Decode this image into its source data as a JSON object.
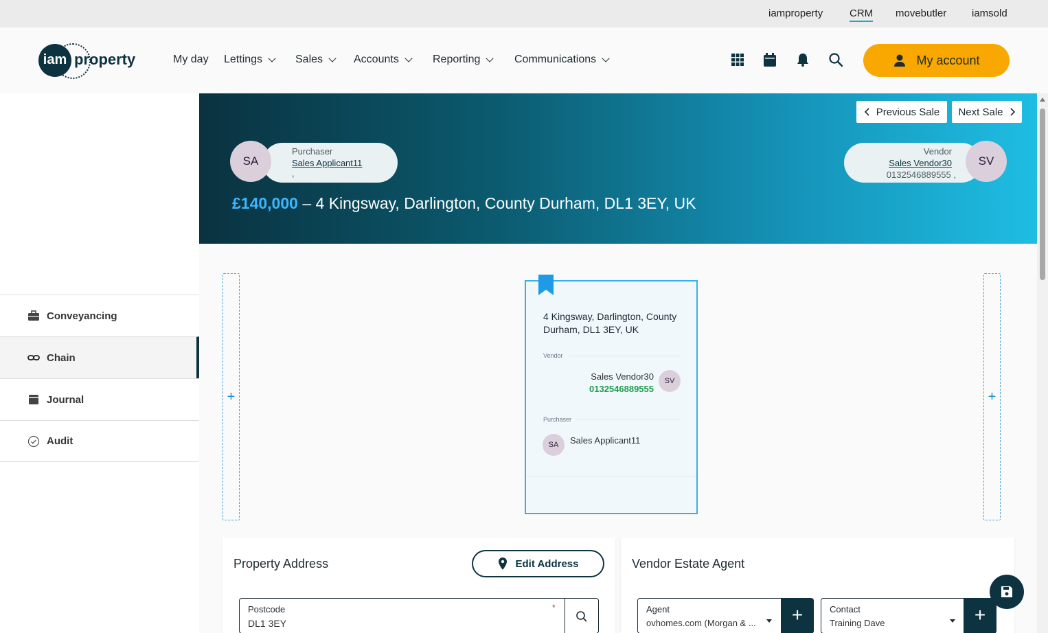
{
  "top_links": [
    "iamproperty",
    "CRM",
    "movebutler",
    "iamsold"
  ],
  "logo": {
    "mark": "iam",
    "word": "property"
  },
  "nav": {
    "my_day": "My day",
    "lettings": "Lettings",
    "sales": "Sales",
    "accounts": "Accounts",
    "reporting": "Reporting",
    "communications": "Communications"
  },
  "header_icons": [
    "apps-grid-icon",
    "calendar-icon",
    "bell-icon",
    "search-icon"
  ],
  "my_account": "My account",
  "sidebar": {
    "items": [
      {
        "label": "Conveyancing",
        "icon": "briefcase-icon"
      },
      {
        "label": "Chain",
        "icon": "link-icon"
      },
      {
        "label": "Journal",
        "icon": "journal-icon"
      },
      {
        "label": "Audit",
        "icon": "check-circle-icon"
      }
    ],
    "active": "Chain"
  },
  "banner": {
    "previous_sale": "Previous Sale",
    "next_sale": "Next Sale",
    "purchaser": {
      "label": "Purchaser",
      "name": "Sales Applicant11",
      "extra": ",",
      "initials": "SA"
    },
    "vendor": {
      "label": "Vendor",
      "name": "Sales Vendor30",
      "phone": "0132546889555 ,",
      "initials": "SV"
    },
    "price": "£140,000",
    "address": " – 4 Kingsway, Darlington, County Durham, DL1 3EY, UK"
  },
  "chain_card": {
    "address": "4 Kingsway, Darlington, County Durham, DL1 3EY, UK",
    "vendor_label": "Vendor",
    "vendor_name": "Sales Vendor30",
    "vendor_phone": "0132546889555",
    "vendor_initials": "SV",
    "purchaser_label": "Purchaser",
    "purchaser_name": "Sales Applicant11",
    "purchaser_initials": "SA"
  },
  "chain_add": "+",
  "property_panel": {
    "title": "Property Address",
    "edit_button": "Edit Address",
    "postcode_label": "Postcode",
    "postcode_value": "DL1 3EY",
    "required_mark": "*"
  },
  "vendor_agent_panel": {
    "title": "Vendor Estate Agent",
    "agent_label": "Agent",
    "agent_value": "ovhomes.com (Morgan & ...",
    "contact_label": "Contact",
    "contact_value": "Training Dave",
    "add": "+"
  },
  "colors": {
    "brand_dark": "#0e3340",
    "accent_orange": "#f8a800",
    "price_blue": "#3cb6ff",
    "phone_green": "#1f9a4a"
  }
}
